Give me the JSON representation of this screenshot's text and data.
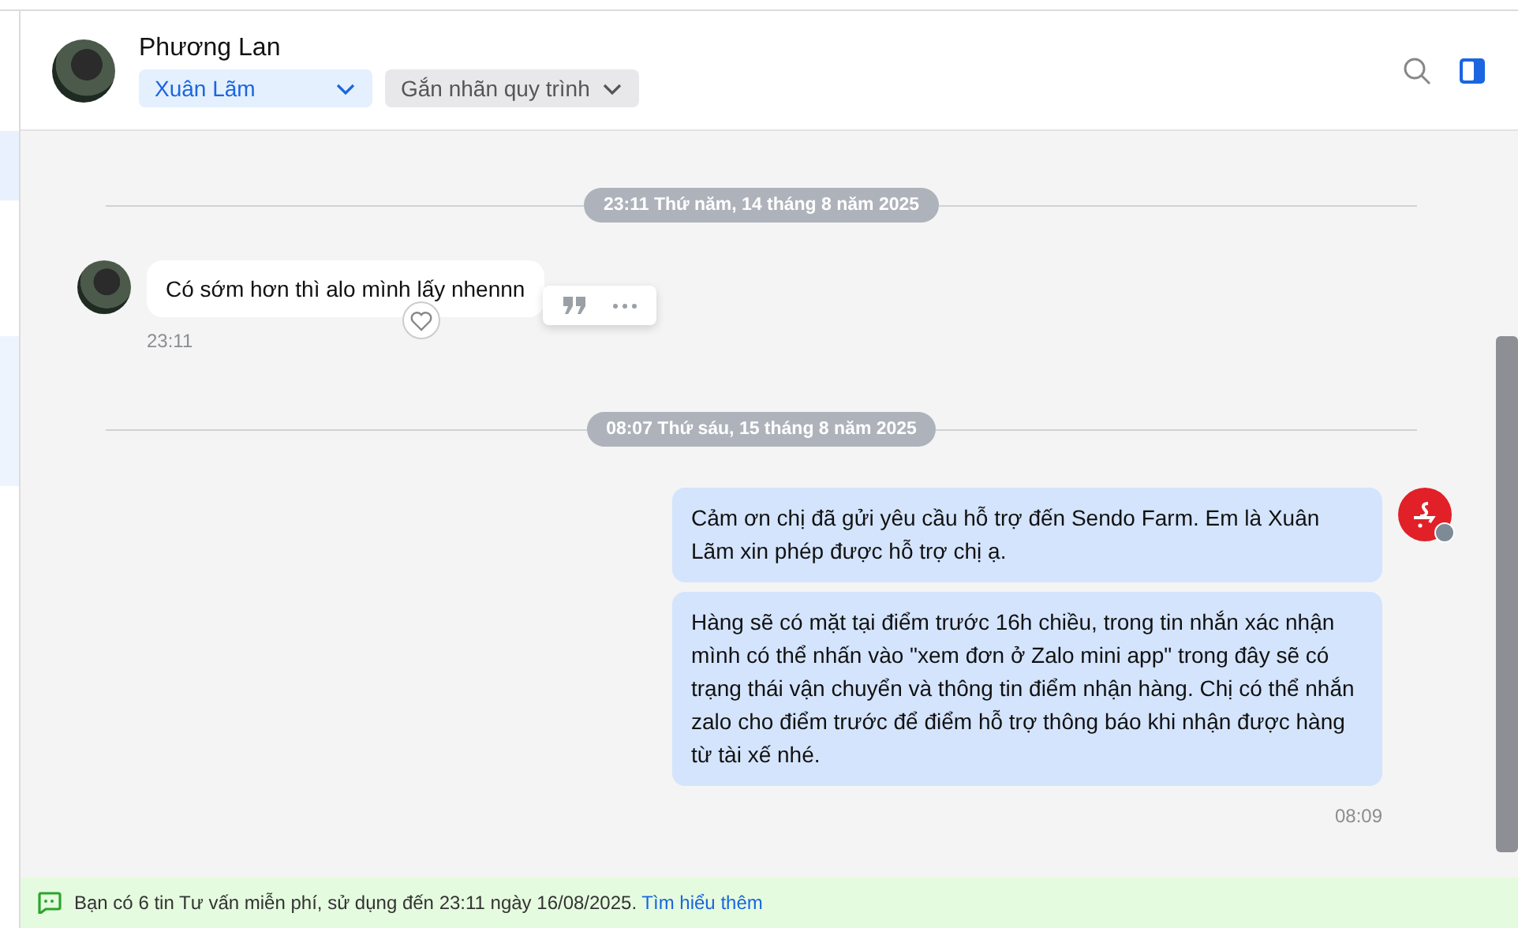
{
  "contact": {
    "name": "Phương Lan",
    "assignee": "Xuân Lãm",
    "label_placeholder": "Gắn nhãn quy trình"
  },
  "messages": [
    {
      "kind": "divider",
      "text": "23:11 Thứ năm, 14 tháng 8 năm 2025"
    },
    {
      "kind": "incoming",
      "bubbles": [
        "Có sớm hơn thì alo mình lấy nhennn"
      ],
      "time": "23:11"
    },
    {
      "kind": "divider",
      "text": "08:07 Thứ sáu, 15 tháng 8 năm 2025"
    },
    {
      "kind": "outgoing",
      "bubbles": [
        "Cảm ơn chị đã gửi yêu cầu hỗ trợ đến Sendo Farm. Em là Xuân Lãm xin phép được hỗ trợ chị ạ.",
        "Hàng sẽ có mặt tại điểm trước 16h chiều, trong tin nhắn xác nhận mình có thể nhấn vào \"xem đơn ở Zalo mini app\" trong đây sẽ có trạng thái vận chuyển và thông tin điểm nhận hàng. Chị có thể nhắn zalo cho điểm trước để điểm hỗ trợ thông báo khi nhận được hàng từ tài xế nhé."
      ],
      "time": "08:09"
    }
  ],
  "banner": {
    "text": "Bạn có 6 tin Tư vấn miễn phí, sử dụng đến 23:11 ngày 16/08/2025.",
    "link": "Tìm hiểu thêm"
  }
}
